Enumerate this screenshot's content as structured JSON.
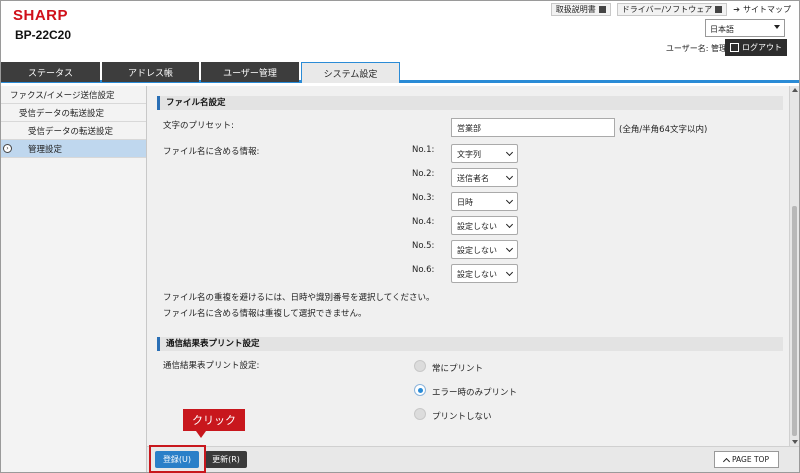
{
  "header": {
    "brand": "SHARP",
    "model": "BP-22C20",
    "links": [
      "取扱説明書",
      "ドライバー/ソフトウェア"
    ],
    "sitemap": "サイトマップ",
    "language": "日本語",
    "user_label": "ユーザー名: 管理者",
    "logout": "ログアウト"
  },
  "tabs": [
    "ステータス",
    "アドレス帳",
    "ユーザー管理",
    "システム設定"
  ],
  "sidebar": {
    "items": [
      "ファクス/イメージ送信設定",
      "受信データの転送設定",
      "受信データの転送設定",
      "管理設定"
    ]
  },
  "section1": {
    "title": "ファイル名設定",
    "preset_label": "文字のプリセット:",
    "preset_value": "営業部",
    "preset_hint": "(全角/半角64文字以内)",
    "include_label": "ファイル名に含める情報:",
    "rows": [
      {
        "no": "No.1:",
        "value": "文字列"
      },
      {
        "no": "No.2:",
        "value": "送信者名"
      },
      {
        "no": "No.3:",
        "value": "日時"
      },
      {
        "no": "No.4:",
        "value": "設定しない"
      },
      {
        "no": "No.5:",
        "value": "設定しない"
      },
      {
        "no": "No.6:",
        "value": "設定しない"
      }
    ],
    "note1": "ファイル名の重複を避けるには、日時や識別番号を選択してください。",
    "note2": "ファイル名に含める情報は重複して選択できません。"
  },
  "section2": {
    "title": "通信結果表プリント設定",
    "label": "通信結果表プリント設定:",
    "options": [
      "常にプリント",
      "エラー時のみプリント",
      "プリントしない"
    ],
    "selected_index": 1
  },
  "footer": {
    "register": "登録(U)",
    "update": "更新(R)",
    "callout": "クリック",
    "page_top": "PAGE TOP"
  },
  "colors": {
    "brand": "#d0101a",
    "accent": "#2a8bd6",
    "callout": "#c8171d"
  }
}
